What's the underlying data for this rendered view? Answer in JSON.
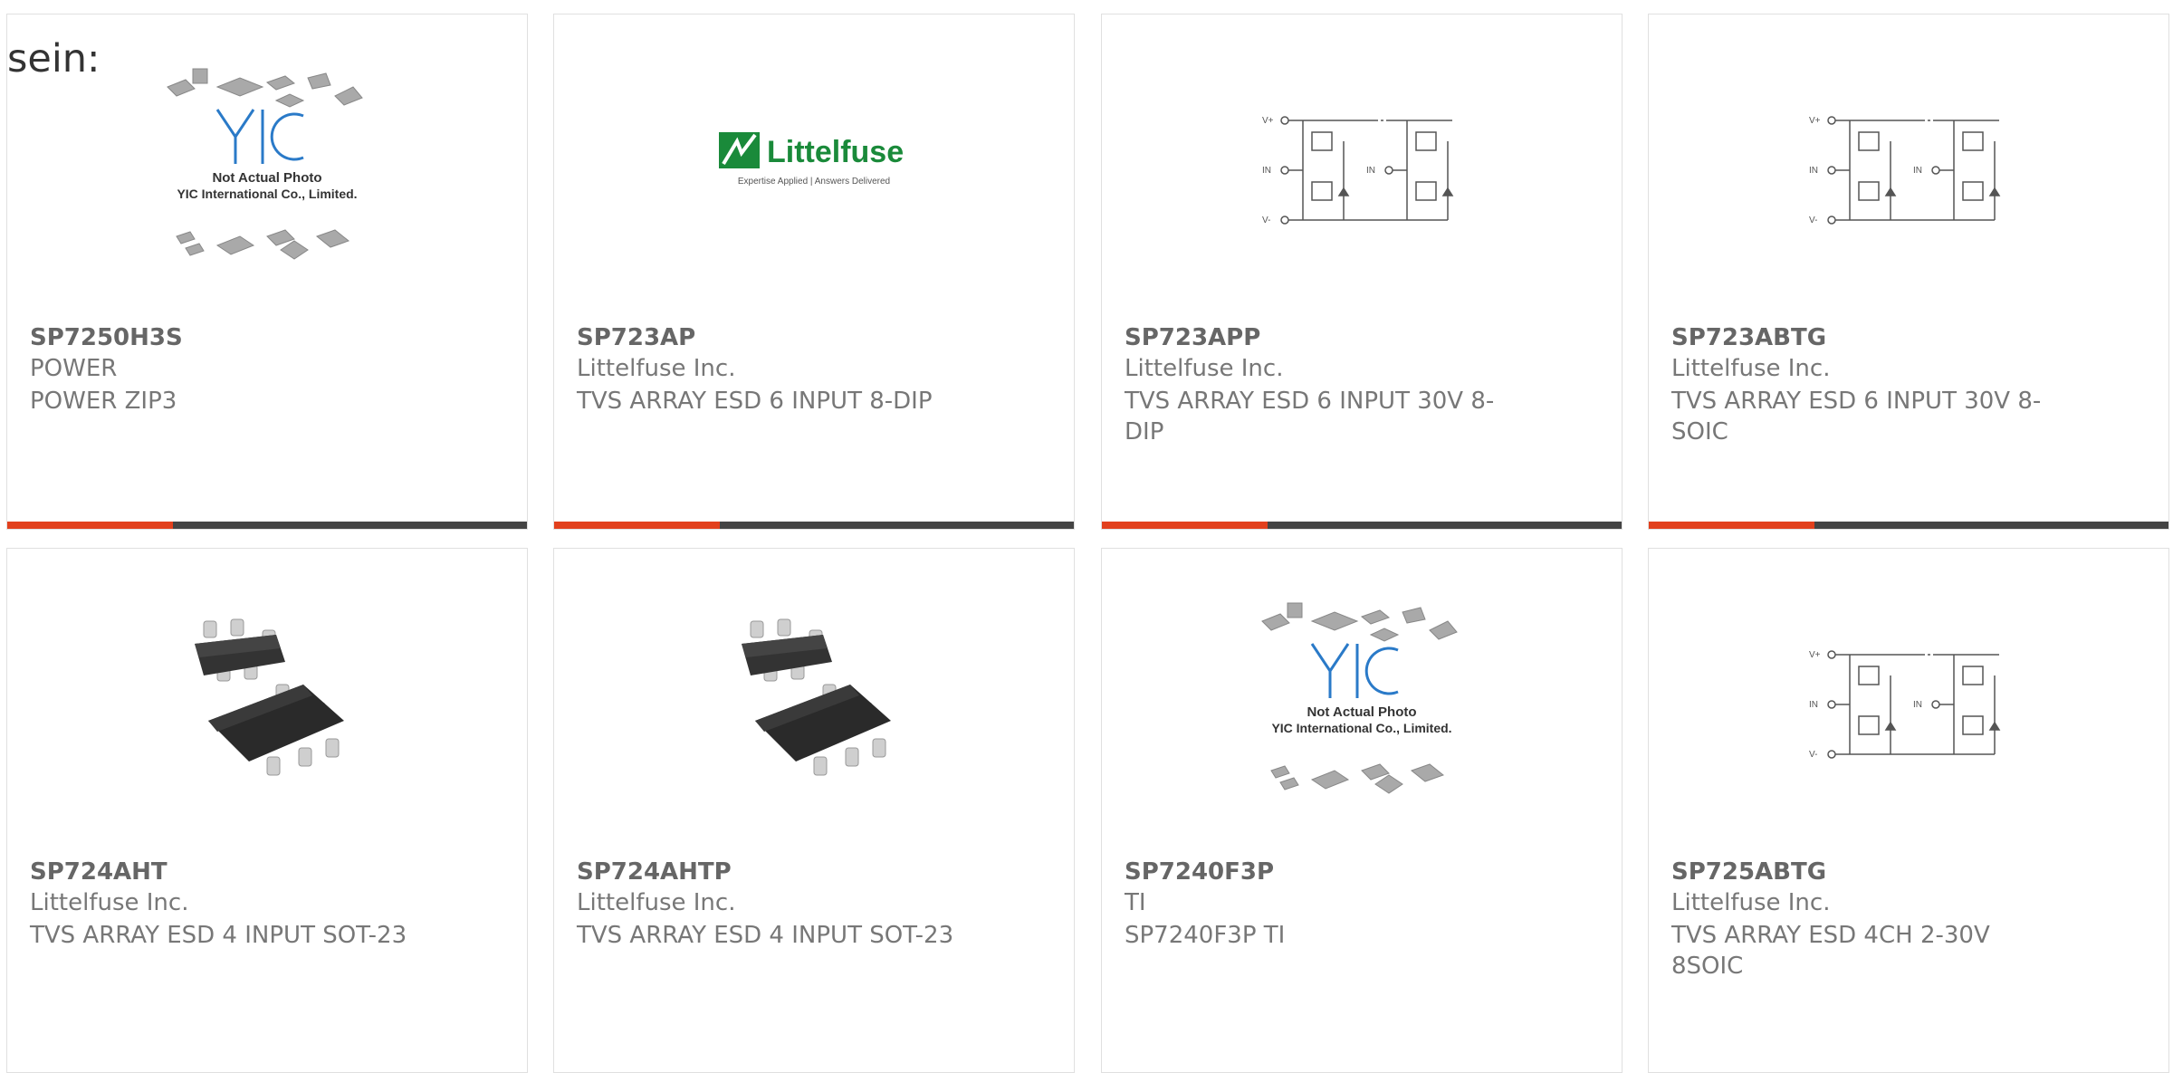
{
  "heading": "sein:",
  "brand_colors": {
    "accent": "#e2401d",
    "bar": "#444444",
    "littelfuse_green": "#1a8a3a"
  },
  "placeholder_photo": {
    "line1": "Not Actual Photo",
    "line2": "YIC International Co., Limited."
  },
  "littelfuse_logo": {
    "name": "Littelfuse",
    "tagline": "Expertise Applied | Answers Delivered"
  },
  "circuit_labels": {
    "vplus": "V+",
    "in": "IN",
    "vminus": "V-"
  },
  "products": [
    {
      "part": "SP7250H3S",
      "manufacturer": "POWER",
      "description": "POWER ZIP3",
      "image": "yic-placeholder"
    },
    {
      "part": "SP723AP",
      "manufacturer": "Littelfuse Inc.",
      "description": "TVS ARRAY ESD 6 INPUT 8-DIP",
      "image": "littelfuse-logo"
    },
    {
      "part": "SP723APP",
      "manufacturer": "Littelfuse Inc.",
      "description": "TVS ARRAY ESD 6 INPUT 30V 8-DIP",
      "image": "circuit-diagram"
    },
    {
      "part": "SP723ABTG",
      "manufacturer": "Littelfuse Inc.",
      "description": "TVS ARRAY ESD 6 INPUT 30V 8-SOIC",
      "image": "circuit-diagram"
    },
    {
      "part": "SP724AHT",
      "manufacturer": "Littelfuse Inc.",
      "description": "TVS ARRAY ESD 4 INPUT SOT-23",
      "image": "sot23-package"
    },
    {
      "part": "SP724AHTP",
      "manufacturer": "Littelfuse Inc.",
      "description": "TVS ARRAY ESD 4 INPUT SOT-23",
      "image": "sot23-package"
    },
    {
      "part": "SP7240F3P",
      "manufacturer": "TI",
      "description": "SP7240F3P TI",
      "image": "yic-placeholder"
    },
    {
      "part": "SP725ABTG",
      "manufacturer": "Littelfuse Inc.",
      "description": "TVS ARRAY ESD 4CH 2-30V 8SOIC",
      "image": "circuit-diagram"
    }
  ]
}
